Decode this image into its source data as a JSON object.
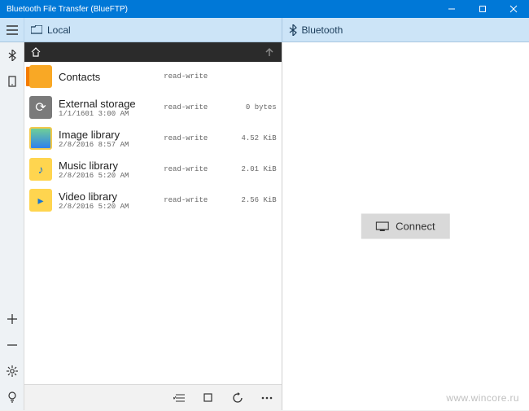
{
  "window": {
    "title": "Bluetooth File Transfer (BlueFTP)"
  },
  "toolbar": {
    "local_label": "Local",
    "bluetooth_label": "Bluetooth"
  },
  "files": {
    "items": [
      {
        "name": "Contacts",
        "date": "",
        "perm": "read-write",
        "size": "",
        "icon": "contacts"
      },
      {
        "name": "External storage",
        "date": "1/1/1601 3:00 AM",
        "perm": "read-write",
        "size": "0 bytes",
        "icon": "ext"
      },
      {
        "name": "Image library",
        "date": "2/8/2016 8:57 AM",
        "perm": "read-write",
        "size": "4.52 KiB",
        "icon": "img"
      },
      {
        "name": "Music library",
        "date": "2/8/2016 5:20 AM",
        "perm": "read-write",
        "size": "2.01 KiB",
        "icon": "music"
      },
      {
        "name": "Video library",
        "date": "2/8/2016 5:20 AM",
        "perm": "read-write",
        "size": "2.56 KiB",
        "icon": "video"
      }
    ]
  },
  "right": {
    "connect_label": "Connect"
  },
  "watermark": "www.wincore.ru"
}
